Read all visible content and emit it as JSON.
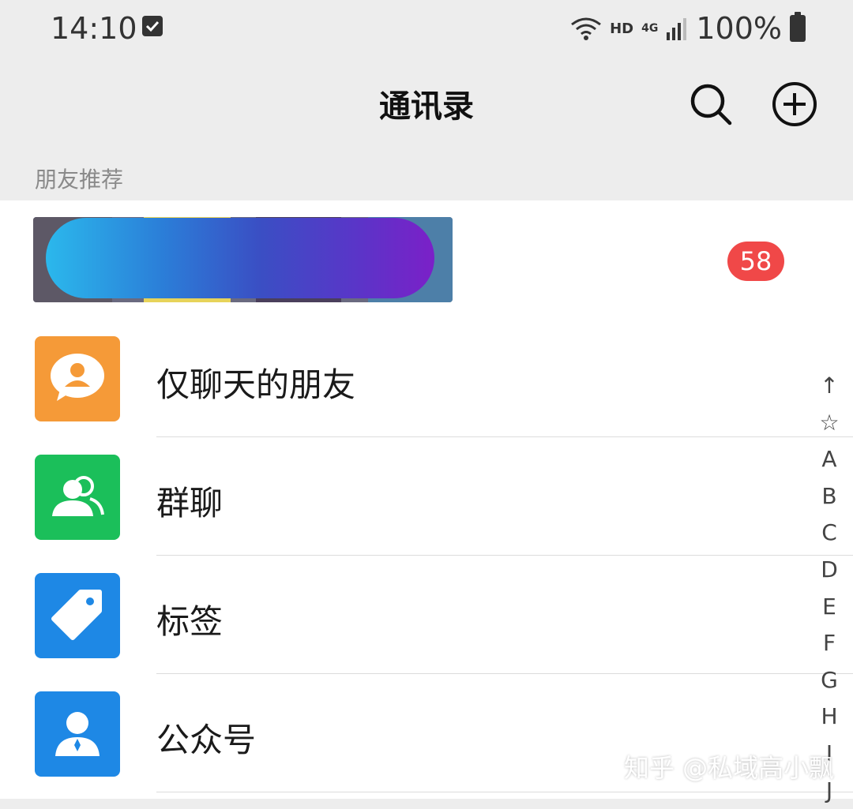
{
  "status_bar": {
    "time": "14:10",
    "hd": "HD",
    "network": "4G",
    "battery": "100%"
  },
  "header": {
    "title": "通讯录",
    "search_icon": "search-icon",
    "add_icon": "plus-circle-icon"
  },
  "section": {
    "label": "朋友推荐"
  },
  "recommend": {
    "badge": "58"
  },
  "menu": [
    {
      "label": "仅聊天的朋友",
      "icon": "chat-only-friends-icon",
      "color": "#f59a38"
    },
    {
      "label": "群聊",
      "icon": "group-chat-icon",
      "color": "#1bbf5a"
    },
    {
      "label": "标签",
      "icon": "tag-icon",
      "color": "#1e88e5"
    },
    {
      "label": "公众号",
      "icon": "official-account-icon",
      "color": "#1e88e5"
    }
  ],
  "index": [
    "↑",
    "☆",
    "A",
    "B",
    "C",
    "D",
    "E",
    "F",
    "G",
    "H",
    "I",
    "J"
  ],
  "watermark": "知乎 @私域高小飘"
}
